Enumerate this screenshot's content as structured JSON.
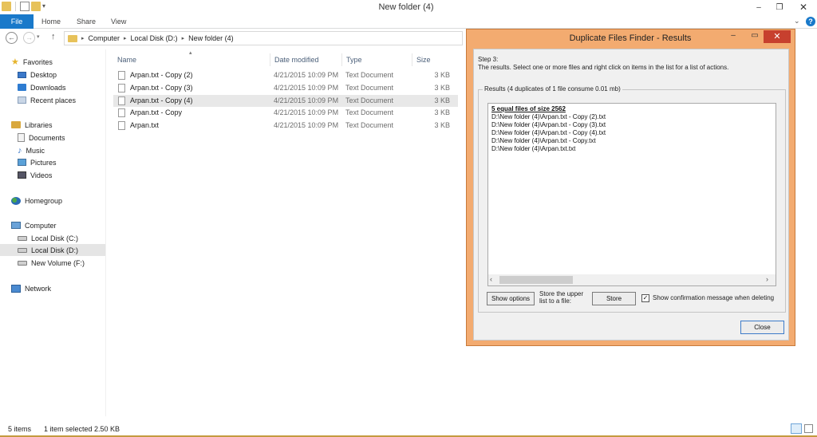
{
  "window": {
    "title": "New folder (4)",
    "minimize": "–",
    "maximize": "❐",
    "close": "✕"
  },
  "ribbon": {
    "tabs": [
      "File",
      "Home",
      "Share",
      "View"
    ],
    "help": "?"
  },
  "address": {
    "crumbs": [
      "Computer",
      "Local Disk (D:)",
      "New folder (4)"
    ]
  },
  "navpane": {
    "favorites": {
      "label": "Favorites",
      "items": [
        "Desktop",
        "Downloads",
        "Recent places"
      ]
    },
    "libraries": {
      "label": "Libraries",
      "items": [
        "Documents",
        "Music",
        "Pictures",
        "Videos"
      ]
    },
    "homegroup": "Homegroup",
    "computer": {
      "label": "Computer",
      "items": [
        "Local Disk (C:)",
        "Local Disk (D:)",
        "New Volume (F:)"
      ]
    },
    "network": "Network"
  },
  "filelist": {
    "columns": [
      "Name",
      "Date modified",
      "Type",
      "Size"
    ],
    "rows": [
      {
        "name": "Arpan.txt - Copy (2)",
        "date": "4/21/2015 10:09 PM",
        "type": "Text Document",
        "size": "3 KB"
      },
      {
        "name": "Arpan.txt - Copy (3)",
        "date": "4/21/2015 10:09 PM",
        "type": "Text Document",
        "size": "3 KB"
      },
      {
        "name": "Arpan.txt - Copy (4)",
        "date": "4/21/2015 10:09 PM",
        "type": "Text Document",
        "size": "3 KB"
      },
      {
        "name": "Arpan.txt - Copy",
        "date": "4/21/2015 10:09 PM",
        "type": "Text Document",
        "size": "3 KB"
      },
      {
        "name": "Arpan.txt",
        "date": "4/21/2015 10:09 PM",
        "type": "Text Document",
        "size": "3 KB"
      }
    ]
  },
  "status": {
    "count": "5 items",
    "selection": "1 item selected  2.50 KB"
  },
  "dialog": {
    "title": "Duplicate Files Finder - Results",
    "step": "Step 3:",
    "description": "The results. Select one or more files and right click on items in the list for a list of actions.",
    "group_label": "Results (4 duplicates of 1 file consume 0.01 mb)",
    "results_title": "5 equal files of size 2562",
    "results_lines": [
      "D:\\New folder (4)\\Arpan.txt - Copy (2).txt",
      "D:\\New folder (4)\\Arpan.txt - Copy (3).txt",
      "D:\\New folder (4)\\Arpan.txt - Copy (4).txt",
      "D:\\New folder (4)\\Arpan.txt - Copy.txt",
      "D:\\New folder (4)\\Arpan.txt.txt"
    ],
    "show_options": "Show options",
    "store_label": "Store the upper list to a file:",
    "store": "Store",
    "confirm_checked": "✓",
    "confirm_label": "Show confirmation message when deleting",
    "close": "Close"
  }
}
